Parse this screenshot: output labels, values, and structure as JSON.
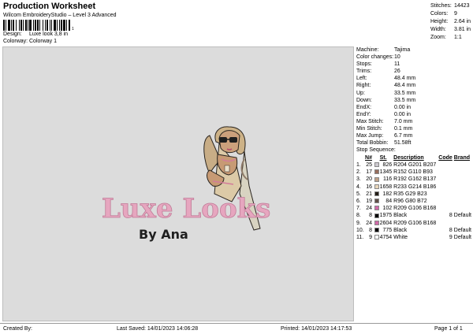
{
  "header": {
    "title": "Production Worksheet",
    "subtitle": "Wilcom EmbroideryStudio – Level 3 Advanced",
    "barcode_number": "1",
    "design_label": "Design:",
    "design_value": "Luxe look 3,8 in",
    "colorway_label": "Colorway:",
    "colorway_value": "Colorway 1"
  },
  "stats": [
    {
      "label": "Stitches:",
      "value": "14423"
    },
    {
      "label": "Colors:",
      "value": "9"
    },
    {
      "label": "Height:",
      "value": "2.64 in"
    },
    {
      "label": "Width:",
      "value": "3.81 in"
    },
    {
      "label": "Zoom:",
      "value": "1:1"
    }
  ],
  "design_preview": {
    "line1": "Luxe Looks",
    "line2": "By Ana",
    "colors": {
      "text_pink": "#e6a6bf",
      "text_dark": "#1f1f1f",
      "hair": "#cdb287",
      "skin": "#c99b75",
      "outfit": "#d9d4c2",
      "pink_accent": "#d27c99"
    }
  },
  "details": [
    {
      "label": "Machine:",
      "value": "Tajima"
    },
    {
      "label": "Color changes:",
      "value": "10"
    },
    {
      "label": "Stops:",
      "value": "11"
    },
    {
      "label": "Trims:",
      "value": "26"
    },
    {
      "label": "Left:",
      "value": "48.4 mm"
    },
    {
      "label": "Right:",
      "value": "48.4 mm"
    },
    {
      "label": "Up:",
      "value": "33.5 mm"
    },
    {
      "label": "Down:",
      "value": "33.5 mm"
    },
    {
      "label": "EndX:",
      "value": "0.00 in"
    },
    {
      "label": "EndY:",
      "value": "0.00 in"
    },
    {
      "label": "Max Stitch:",
      "value": "7.0 mm"
    },
    {
      "label": "Min Stitch:",
      "value": "0.1 mm"
    },
    {
      "label": "Max Jump:",
      "value": "6.7 mm"
    },
    {
      "label": "Total Bobbin:",
      "value": "51.58ft"
    }
  ],
  "stop_sequence": {
    "title": "Stop Sequence:",
    "headers": {
      "n": "N#",
      "st": "St.",
      "desc": "Description",
      "code": "Code",
      "name": "Brand"
    },
    "rows": [
      {
        "idx": "1.",
        "n": "25",
        "color": "#ccc9cf",
        "st": "826",
        "desc": "R204 G201 B207",
        "code": "",
        "name": ""
      },
      {
        "idx": "2.",
        "n": "17",
        "color": "#986e5d",
        "st": "1345",
        "desc": "R152 G110 B93",
        "code": "",
        "name": ""
      },
      {
        "idx": "3.",
        "n": "20",
        "color": "#c0a289",
        "st": "116",
        "desc": "R192 G162 B137",
        "code": "",
        "name": ""
      },
      {
        "idx": "4.",
        "n": "16",
        "color": "#e9d6ba",
        "st": "1658",
        "desc": "R233 G214 B186",
        "code": "",
        "name": ""
      },
      {
        "idx": "5.",
        "n": "21",
        "color": "#231d17",
        "st": "182",
        "desc": "R35 G29 B23",
        "code": "",
        "name": ""
      },
      {
        "idx": "6.",
        "n": "19",
        "color": "#605048",
        "st": "84",
        "desc": "R96 G80 B72",
        "code": "",
        "name": ""
      },
      {
        "idx": "7.",
        "n": "24",
        "color": "#d16aa8",
        "st": "102",
        "desc": "R209 G106 B168",
        "code": "",
        "name": ""
      },
      {
        "idx": "8.",
        "n": "8",
        "color": "#000000",
        "st": "1975",
        "desc": "Black",
        "code": "8",
        "name": "Default"
      },
      {
        "idx": "9.",
        "n": "24",
        "color": "#d16aa8",
        "st": "2604",
        "desc": "R209 G106 B168",
        "code": "",
        "name": ""
      },
      {
        "idx": "10.",
        "n": "8",
        "color": "#000000",
        "st": "775",
        "desc": "Black",
        "code": "8",
        "name": "Default"
      },
      {
        "idx": "11.",
        "n": "9",
        "color": "#ffffff",
        "st": "4754",
        "desc": "White",
        "code": "9",
        "name": "Default"
      }
    ]
  },
  "footer": {
    "created_by": "Created By:",
    "last_saved": "Last Saved: 14/01/2023 14:06:28",
    "printed": "Printed: 14/01/2023 14:17:53",
    "page": "Page 1 of 1"
  }
}
